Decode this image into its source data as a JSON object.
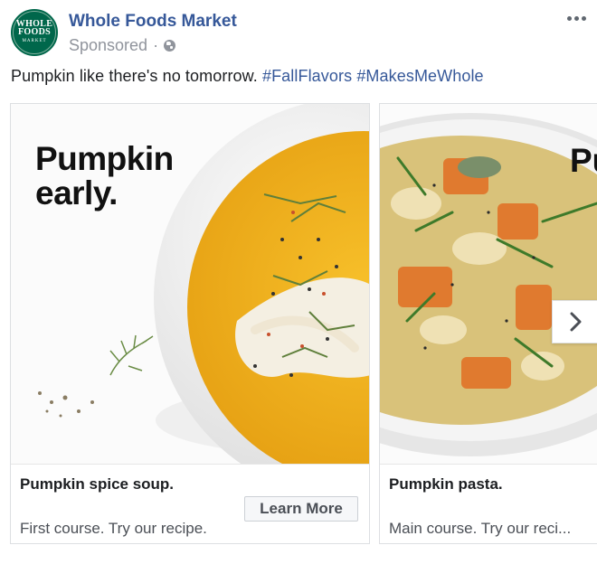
{
  "post": {
    "avatar": {
      "line1": "WHOLE",
      "line2": "FOODS",
      "line3": "MARKET"
    },
    "page_name": "Whole Foods Market",
    "sponsored": "Sponsored",
    "separator": "·",
    "privacy_icon": "globe-icon",
    "more_icon": "more-options-icon",
    "text": "Pumpkin like there's no tomorrow.",
    "hashtags": [
      "#FallFlavors",
      "#MakesMeWhole"
    ]
  },
  "carousel": {
    "cards": [
      {
        "image_headline_line1": "Pumpkin",
        "image_headline_line2": "early.",
        "title": "Pumpkin spice soup.",
        "description": "First course. Try our recipe.",
        "cta": "Learn More"
      },
      {
        "image_headline_line1": "Pu",
        "title": "Pumpkin pasta.",
        "description": "Main course. Try our reci..."
      }
    ],
    "next_icon": "chevron-right-icon"
  },
  "colors": {
    "link": "#365899",
    "brand_green": "#00674b",
    "soup": "#f0b21c",
    "secondary_text": "#90949c"
  }
}
